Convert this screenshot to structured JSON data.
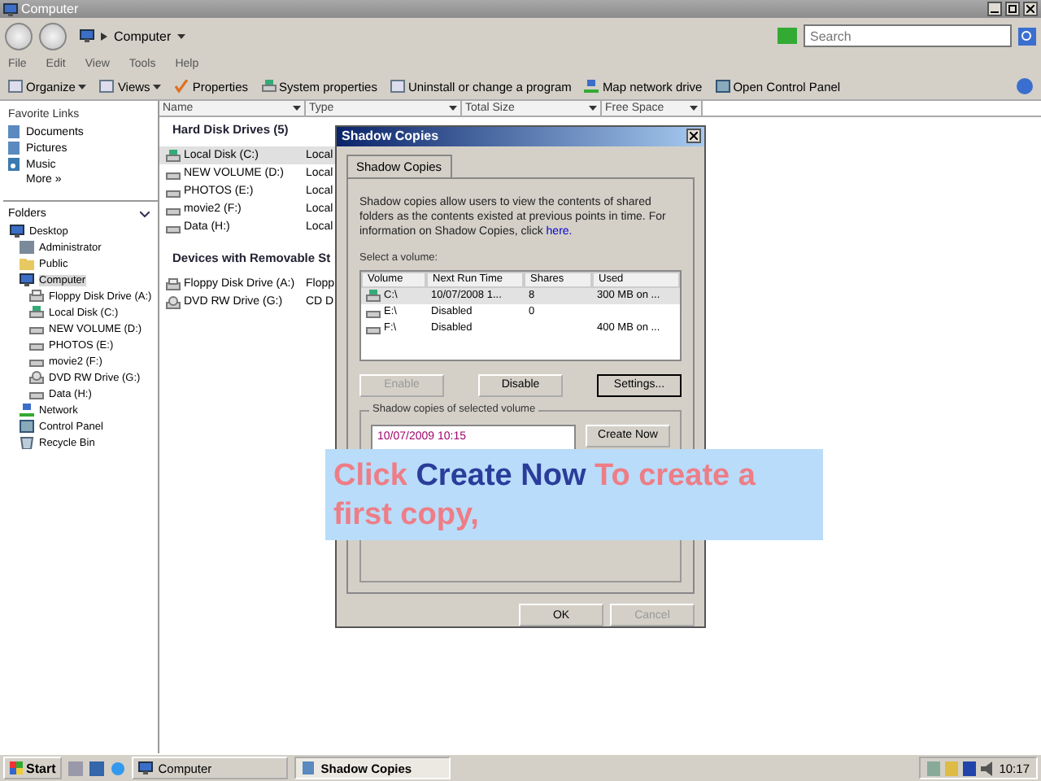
{
  "window": {
    "title": "Computer"
  },
  "address": {
    "path": "Computer",
    "search_placeholder": "Search"
  },
  "menu": [
    "File",
    "Edit",
    "View",
    "Tools",
    "Help"
  ],
  "toolbar": [
    {
      "label": "Organize",
      "kind": "organize",
      "dropdown": true
    },
    {
      "label": "Views",
      "kind": "views",
      "dropdown": true
    },
    {
      "label": "Properties",
      "kind": "check",
      "dropdown": false
    },
    {
      "label": "System properties",
      "kind": "system",
      "dropdown": false
    },
    {
      "label": "Uninstall or change a program",
      "kind": "uninstall",
      "dropdown": false
    },
    {
      "label": "Map network drive",
      "kind": "network",
      "dropdown": false
    },
    {
      "label": "Open Control Panel",
      "kind": "panel",
      "dropdown": false
    }
  ],
  "favorites": {
    "title": "Favorite Links",
    "items": [
      {
        "label": "Documents",
        "kind": "doc"
      },
      {
        "label": "Pictures",
        "kind": "doc"
      },
      {
        "label": "Music",
        "kind": "music"
      }
    ],
    "more": "More »"
  },
  "folders": {
    "title": "Folders",
    "tree": [
      {
        "label": "Desktop",
        "kind": "desktop",
        "selected": false,
        "children": [
          {
            "label": "Administrator",
            "kind": "user",
            "selected": false
          },
          {
            "label": "Public",
            "kind": "folder",
            "selected": false
          },
          {
            "label": "Computer",
            "kind": "computer",
            "selected": true,
            "children": [
              {
                "label": "Floppy Disk Drive (A:)",
                "kind": "floppy",
                "selected": false
              },
              {
                "label": "Local Disk (C:)",
                "kind": "system",
                "selected": false
              },
              {
                "label": "NEW VOLUME (D:)",
                "kind": "drive",
                "selected": false
              },
              {
                "label": "PHOTOS (E:)",
                "kind": "drive",
                "selected": false
              },
              {
                "label": "movie2 (F:)",
                "kind": "drive",
                "selected": false
              },
              {
                "label": "DVD RW Drive (G:)",
                "kind": "dvd",
                "selected": false
              },
              {
                "label": "Data (H:)",
                "kind": "drive",
                "selected": false
              }
            ]
          },
          {
            "label": "Network",
            "kind": "network",
            "selected": false
          },
          {
            "label": "Control Panel",
            "kind": "panel",
            "selected": false
          },
          {
            "label": "Recycle Bin",
            "kind": "bin",
            "selected": false
          }
        ]
      }
    ]
  },
  "columns": [
    "Name",
    "Type",
    "Total Size",
    "Free Space"
  ],
  "groups": [
    {
      "title": "Hard Disk Drives (5)",
      "items": [
        {
          "name": "Local Disk (C:)",
          "type": "Local",
          "kind": "system",
          "selected": true
        },
        {
          "name": "NEW VOLUME (D:)",
          "type": "Local",
          "kind": "drive",
          "selected": false
        },
        {
          "name": "PHOTOS (E:)",
          "type": "Local",
          "kind": "drive",
          "selected": false
        },
        {
          "name": "movie2 (F:)",
          "type": "Local",
          "kind": "drive",
          "selected": false
        },
        {
          "name": "Data (H:)",
          "type": "Local",
          "kind": "drive",
          "selected": false
        }
      ]
    },
    {
      "title": "Devices with Removable St",
      "items": [
        {
          "name": "Floppy Disk Drive (A:)",
          "type": "Flopp",
          "kind": "floppy",
          "selected": false
        },
        {
          "name": "DVD RW Drive (G:)",
          "type": "CD D",
          "kind": "dvd",
          "selected": false
        }
      ]
    }
  ],
  "dialog": {
    "title": "Shadow Copies",
    "tab": "Shadow Copies",
    "description": "Shadow copies allow users to view the contents of shared folders as the contents existed at previous points in time. For information on Shadow Copies, click ",
    "link": "here.",
    "select_label": "Select a volume:",
    "columns": [
      "Volume",
      "Next Run Time",
      "Shares",
      "Used"
    ],
    "volumes": [
      {
        "volume": "C:\\",
        "next_run": "10/07/2008 1...",
        "shares": "8",
        "used": "300 MB on ...",
        "kind": "system",
        "selected": true
      },
      {
        "volume": "E:\\",
        "next_run": "Disabled",
        "shares": "0",
        "kind": "drive",
        "selected": false
      },
      {
        "volume": "F:\\",
        "next_run": "Disabled",
        "used": "400 MB on ...",
        "kind": "drive",
        "selected": false
      }
    ],
    "buttons": [
      {
        "label": "Enable",
        "disabled": true,
        "default": false
      },
      {
        "label": "Disable",
        "disabled": false,
        "default": false
      },
      {
        "label": "Settings...",
        "disabled": false,
        "default": true
      }
    ],
    "copies_label": "Shadow copies of selected volume",
    "copies": [
      "10/07/2009 10:15"
    ],
    "create_now": "Create Now",
    "footer": [
      {
        "label": "OK",
        "disabled": false
      },
      {
        "label": "Cancel",
        "disabled": true
      }
    ]
  },
  "callout": [
    {
      "text": "Click ",
      "kind": "plain"
    },
    {
      "text": "Create Now",
      "kind": "emphasis"
    },
    {
      "text": " To create a first copy,",
      "kind": "plain"
    }
  ],
  "taskbar": {
    "start": "Start",
    "tasks": [
      {
        "label": "Computer",
        "selected": false
      },
      {
        "label": "Shadow Copies",
        "selected": true
      }
    ],
    "clock": "10:17"
  }
}
